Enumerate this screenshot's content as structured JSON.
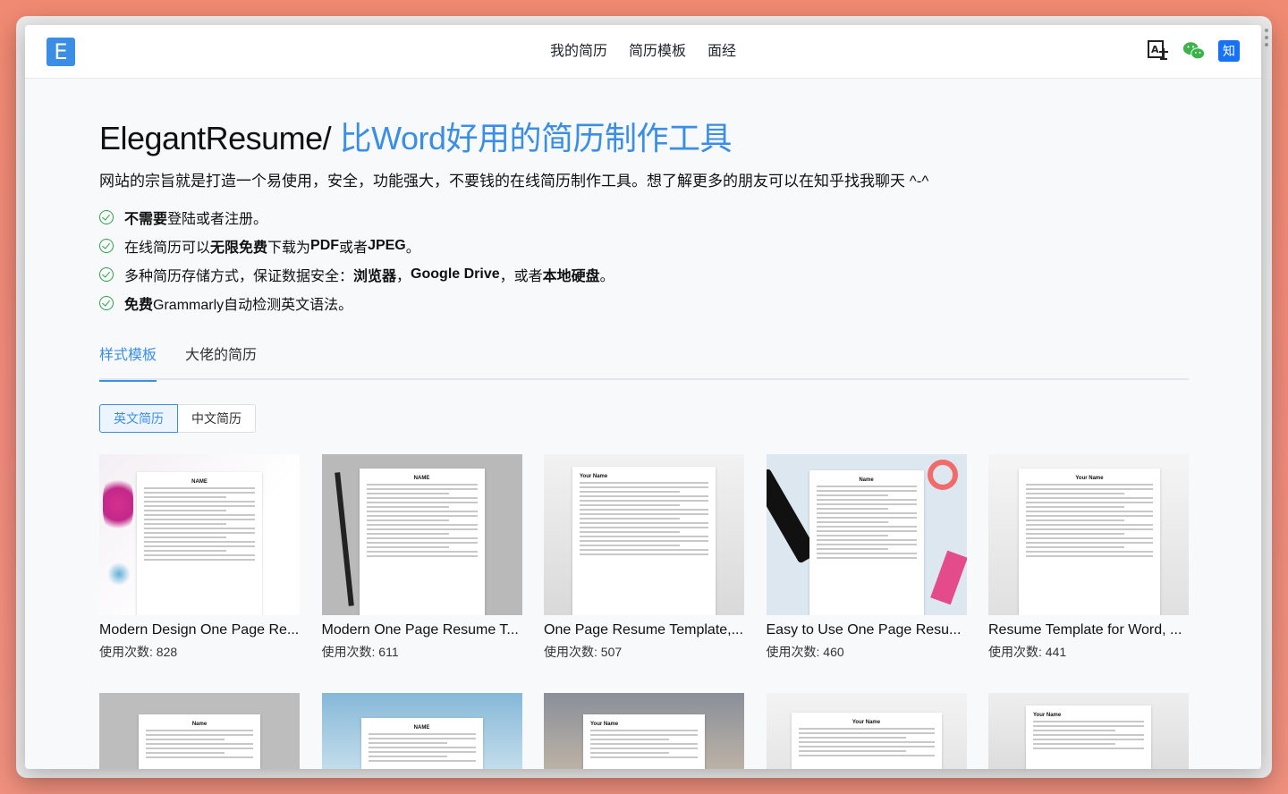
{
  "app": {
    "logo_letter": "E"
  },
  "nav": {
    "items": [
      "我的简历",
      "简历模板",
      "面经"
    ]
  },
  "header_icons": {
    "translate": "translate-icon",
    "wechat": "wechat-icon",
    "zhihu_label": "知"
  },
  "hero": {
    "title_prefix": "ElegantResume/",
    "title_accent": "比Word好用的简历制作工具",
    "description": "网站的宗旨就是打造一个易使用，安全，功能强大，不要钱的在线简历制作工具。想了解更多的朋友可以在知乎找我聊天 ^-^",
    "features": [
      {
        "bold": "不需要",
        "rest": "登陆或者注册。"
      },
      {
        "pre": "在线简历可以",
        "bold": "无限免费",
        "mid": "下载为",
        "bold2": "PDF",
        "mid2": "或者",
        "bold3": "JPEG",
        "rest": "。"
      },
      {
        "pre": "多种简历存储方式，保证数据安全：",
        "bold": "浏览器",
        "mid": "，",
        "bold2": "Google Drive",
        "mid2": "，或者",
        "bold3": "本地硬盘",
        "rest": "。"
      },
      {
        "bold": "免费",
        "rest": " Grammarly自动检测英文语法。"
      }
    ]
  },
  "tabs": [
    {
      "label": "样式模板",
      "active": true
    },
    {
      "label": "大佬的简历",
      "active": false
    }
  ],
  "segment": [
    {
      "label": "英文简历",
      "active": true
    },
    {
      "label": "中文简历",
      "active": false
    }
  ],
  "count_label": "使用次数: ",
  "templates": [
    {
      "title": "Modern Design One Page Re...",
      "count": 828
    },
    {
      "title": "Modern One Page Resume T...",
      "count": 611
    },
    {
      "title": "One Page Resume Template,...",
      "count": 507
    },
    {
      "title": "Easy to Use One Page Resu...",
      "count": 460
    },
    {
      "title": "Resume Template for Word, ...",
      "count": 441
    }
  ],
  "thumb_headings": [
    "NAME",
    "NAME",
    "Your Name",
    "Name",
    "Your Name",
    "Name",
    "NAME",
    "Your Name",
    "Your Name",
    "Your Name"
  ],
  "colors": {
    "accent": "#3a8ee6",
    "check": "#2ea24a"
  }
}
